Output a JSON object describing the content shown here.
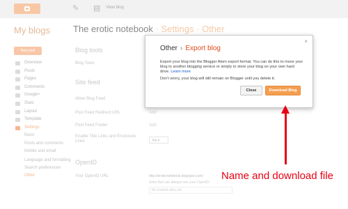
{
  "topbar": {
    "view_blog": "View blog"
  },
  "header": {
    "my_blogs": "My blogs",
    "blog_name": "The erotic notebook",
    "separator": "·",
    "crumb_settings": "Settings",
    "crumb_other": "Other"
  },
  "sidebar": {
    "new_post": "New post",
    "items": [
      "Overview",
      "Posts",
      "Pages",
      "Comments",
      "Google+",
      "Stats",
      "Layout",
      "Template",
      "Settings"
    ],
    "sub_items": [
      "Basic",
      "Posts and comments",
      "Mobile and email",
      "Language and formatting",
      "Search preferences",
      "Other"
    ]
  },
  "main": {
    "blog_tools_title": "Blog tools",
    "blog_tools_label": "Blog Tools",
    "site_feed_title": "Site feed",
    "allow_blog_feed": "Allow Blog Feed",
    "redirect_label": "Post Feed Redirect URL",
    "redirect_value": "Add",
    "footer_label": "Post Feed Footer",
    "footer_value": "Add",
    "enclosure_label": "Enable Title Links and Enclosure Links",
    "enclosure_value": "No",
    "openid_title": "OpenID",
    "openid_label": "Your OpenID URL",
    "openid_url": "http://eroticnotebook.blogspot.com/",
    "openid_note": "Sites that can always see your OpenID:",
    "openid_trusted": "No trusted sites yet"
  },
  "dialog": {
    "crumb_other": "Other",
    "chevron": "›",
    "title": "Export blog",
    "close_icon": "×",
    "text": "Export your blog into the Blogger Atom export format. You can do this to move your blog to another blogging service or simply to store your blog on your own hard drive.",
    "learn_more": "Learn more",
    "text2": "Don't worry, your blog will still remain on Blogger until you delete it.",
    "close_label": "Close",
    "download_label": "Download Blog"
  },
  "annotation": {
    "text": "Name and download file",
    "color": "#e60012"
  },
  "colors": {
    "accent": "#f49e4f",
    "title_orange": "#dd4b1a"
  }
}
